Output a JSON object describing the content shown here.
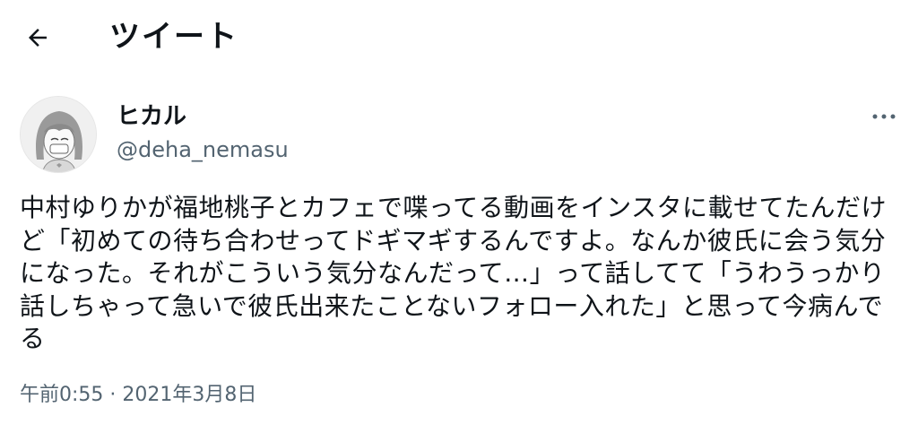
{
  "header": {
    "back_icon": "arrow-left-icon",
    "title": "ツイート"
  },
  "tweet": {
    "author": {
      "avatar_icon": "avatar-illustration-girl",
      "display_name": "ヒカル",
      "handle": "@deha_nemasu"
    },
    "more_icon": "ellipsis-icon",
    "text": "中村ゆりかが福地桃子とカフェで喋ってる動画をインスタに載せてたんだけど「初めての待ち合わせってドギマギするんですよ。なんか彼氏に会う気分になった。それがこういう気分なんだって…」って話してて「うわうっかり話しちゃって急いで彼氏出来たことないフォロー入れた」と思って今病んでる",
    "timestamp": "午前0:55 · 2021年3月8日"
  },
  "colors": {
    "text_primary": "#0f1419",
    "text_secondary": "#536471",
    "background": "#ffffff"
  }
}
